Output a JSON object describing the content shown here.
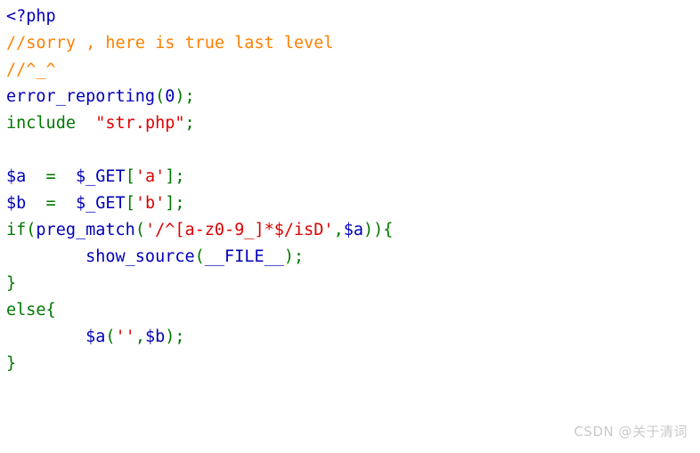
{
  "page": {
    "background_color": "#ffffff",
    "kind": "php-source-highlight"
  },
  "palette": {
    "default": "#0000BB",
    "keyword": "#007700",
    "string": "#DD0000",
    "comment": "#FF8000",
    "html": "#000000",
    "watermark": "#c9c9c9"
  },
  "code": {
    "language": "php",
    "plain_text": "<?php\n//sorry , here is true last level\n//^_^\nerror_reporting(0);\ninclude  \"str.php\";\n\n$a  =  $_GET['a'];\n$b  =  $_GET['b'];\nif(preg_match('/^[a-z0-9_]*$/isD',$a)){\n        show_source(__FILE__);\n}\nelse{\n        $a('',$b);\n}",
    "lines": [
      {
        "index": 1,
        "tokens": [
          {
            "t": "<?php",
            "c": "default"
          }
        ]
      },
      {
        "index": 2,
        "tokens": [
          {
            "t": "//sorry , here is true last level",
            "c": "comment"
          }
        ]
      },
      {
        "index": 3,
        "tokens": [
          {
            "t": "//^_^",
            "c": "comment"
          }
        ]
      },
      {
        "index": 4,
        "tokens": [
          {
            "t": "error_reporting",
            "c": "default"
          },
          {
            "t": "(",
            "c": "keyword"
          },
          {
            "t": "0",
            "c": "default"
          },
          {
            "t": ");",
            "c": "keyword"
          }
        ]
      },
      {
        "index": 5,
        "tokens": [
          {
            "t": "include  ",
            "c": "keyword"
          },
          {
            "t": "\"str.php\"",
            "c": "string"
          },
          {
            "t": ";",
            "c": "keyword"
          }
        ]
      },
      {
        "index": 6,
        "tokens": []
      },
      {
        "index": 7,
        "tokens": [
          {
            "t": "$a",
            "c": "default"
          },
          {
            "t": "  =  ",
            "c": "keyword"
          },
          {
            "t": "$_GET",
            "c": "default"
          },
          {
            "t": "[",
            "c": "keyword"
          },
          {
            "t": "'a'",
            "c": "string"
          },
          {
            "t": "];",
            "c": "keyword"
          }
        ]
      },
      {
        "index": 8,
        "tokens": [
          {
            "t": "$b",
            "c": "default"
          },
          {
            "t": "  =  ",
            "c": "keyword"
          },
          {
            "t": "$_GET",
            "c": "default"
          },
          {
            "t": "[",
            "c": "keyword"
          },
          {
            "t": "'b'",
            "c": "string"
          },
          {
            "t": "];",
            "c": "keyword"
          }
        ]
      },
      {
        "index": 9,
        "tokens": [
          {
            "t": "if(",
            "c": "keyword"
          },
          {
            "t": "preg_match",
            "c": "default"
          },
          {
            "t": "(",
            "c": "keyword"
          },
          {
            "t": "'/^[a-z0-9_]*$/isD'",
            "c": "string"
          },
          {
            "t": ",",
            "c": "keyword"
          },
          {
            "t": "$a",
            "c": "default"
          },
          {
            "t": ")){",
            "c": "keyword"
          }
        ]
      },
      {
        "index": 10,
        "tokens": [
          {
            "t": "        ",
            "c": "keyword"
          },
          {
            "t": "show_source",
            "c": "default"
          },
          {
            "t": "(",
            "c": "keyword"
          },
          {
            "t": "__FILE__",
            "c": "default"
          },
          {
            "t": ");",
            "c": "keyword"
          }
        ]
      },
      {
        "index": 11,
        "tokens": [
          {
            "t": "}",
            "c": "keyword"
          }
        ]
      },
      {
        "index": 12,
        "tokens": [
          {
            "t": "else{",
            "c": "keyword"
          }
        ]
      },
      {
        "index": 13,
        "tokens": [
          {
            "t": "        ",
            "c": "keyword"
          },
          {
            "t": "$a",
            "c": "default"
          },
          {
            "t": "(",
            "c": "keyword"
          },
          {
            "t": "''",
            "c": "string"
          },
          {
            "t": ",",
            "c": "keyword"
          },
          {
            "t": "$b",
            "c": "default"
          },
          {
            "t": ");",
            "c": "keyword"
          }
        ]
      },
      {
        "index": 14,
        "tokens": [
          {
            "t": "}",
            "c": "keyword"
          }
        ]
      }
    ]
  },
  "watermark": {
    "text": "CSDN @关于清词"
  }
}
